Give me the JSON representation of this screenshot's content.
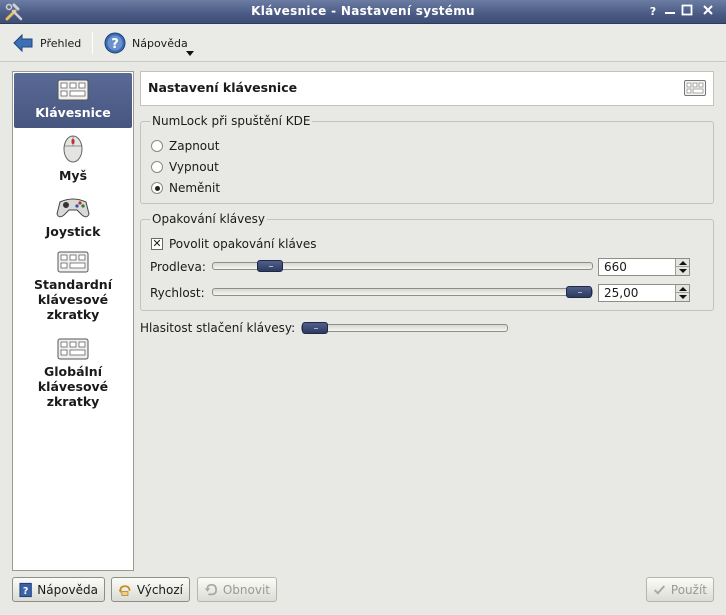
{
  "window": {
    "title": "Klávesnice - Nastavení systému",
    "buttons": {
      "help": "?",
      "minimize": "▬",
      "maximize": "□",
      "close": "✕"
    }
  },
  "toolbar": {
    "overview_label": "Přehled",
    "help_label": "Nápověda"
  },
  "sidebar": {
    "items": [
      {
        "label": "Klávesnice",
        "icon": "keyboard-icon",
        "active": true
      },
      {
        "label": "Myš",
        "icon": "mouse-icon",
        "active": false
      },
      {
        "label": "Joystick",
        "icon": "joystick-icon",
        "active": false
      },
      {
        "label": "Standardní klávesové zkratky",
        "icon": "keyboard-icon",
        "active": false
      },
      {
        "label": "Globální klávesové zkratky",
        "icon": "keyboard-icon",
        "active": false
      }
    ]
  },
  "header": {
    "title": "Nastavení klávesnice"
  },
  "numlock": {
    "title": "NumLock při spuštění KDE",
    "options": [
      {
        "label": "Zapnout",
        "selected": false
      },
      {
        "label": "Vypnout",
        "selected": false
      },
      {
        "label": "Neměnit",
        "selected": true
      }
    ]
  },
  "repeat": {
    "title": "Opakování klávesy",
    "enable_label": "Povolit opakování kláves",
    "enabled": true,
    "delay_label": "Prodleva:",
    "delay_value": "660",
    "delay_level": 0.2,
    "rate_label": "Rychlost:",
    "rate_value": "25,00",
    "rate_level": 1.0
  },
  "click_volume": {
    "label": "Hlasitost stlačení klávesy:",
    "level": 0.0
  },
  "buttons": {
    "help": "Nápověda",
    "defaults": "Výchozí",
    "reset": "Obnovit",
    "apply": "Použít"
  }
}
